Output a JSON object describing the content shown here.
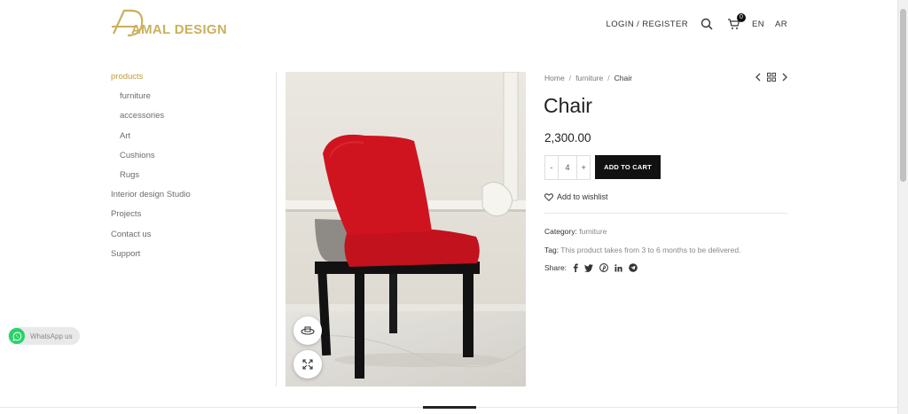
{
  "header": {
    "logo_text": "AMAL DESIGN",
    "login_label": "LOGIN / REGISTER",
    "cart_count": "0",
    "lang_en": "EN",
    "lang_ar": "AR"
  },
  "sidebar": {
    "items": [
      {
        "label": "products"
      },
      {
        "label": "furniture"
      },
      {
        "label": "accessories"
      },
      {
        "label": "Art"
      },
      {
        "label": "Cushions"
      },
      {
        "label": "Rugs"
      },
      {
        "label": "Interior design Studio"
      },
      {
        "label": "Projects"
      },
      {
        "label": "Contact us"
      },
      {
        "label": "Support"
      }
    ]
  },
  "breadcrumb": {
    "home": "Home",
    "category": "furniture",
    "current": "Chair"
  },
  "product": {
    "title": "Chair",
    "price": "2,300.00",
    "qty_minus": "-",
    "qty_value": "4",
    "qty_plus": "+",
    "add_to_cart": "ADD TO CART",
    "wishlist": "Add to wishlist",
    "category_label": "Category:",
    "category_value": "furniture",
    "tag_label": "Tag:",
    "tag_value": "This product takes from 3 to 6 months to be delivered.",
    "share_label": "Share:"
  },
  "whatsapp": {
    "label": "WhatsApp us"
  },
  "colors": {
    "accent_gold": "#cbb05d",
    "link_gold": "#c79a3a",
    "chair_red": "#c7121f",
    "button_black": "#111111"
  }
}
